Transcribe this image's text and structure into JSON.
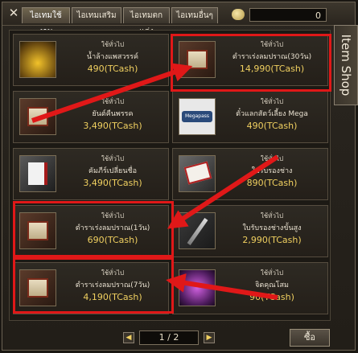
{
  "tabs": [
    {
      "label": "ไอเทมใช้งาน",
      "active": true
    },
    {
      "label": "ไอเทมเสริม",
      "active": false
    },
    {
      "label": "ไอเทมตกแต่ง",
      "active": false
    },
    {
      "label": "ไอเทมอื่นๆ",
      "active": false
    }
  ],
  "cash_balance": "0",
  "side_label": "Item Shop",
  "items": [
    {
      "category": "ใช้ทั่วไป",
      "name": "น้ำล้างแพสวรรค์",
      "price": "490(TCash)",
      "icon": "potion-icon"
    },
    {
      "category": "ใช้ทั่วไป",
      "name": "ตำราเร่งลมปราณ(30วัน)",
      "price": "14,990(TCash)",
      "icon": "scroll-icon"
    },
    {
      "category": "ใช้ทั่วไป",
      "name": "ยันต์คืนพรรค",
      "price": "3,490(TCash)",
      "icon": "scroll-icon"
    },
    {
      "category": "ใช้ทั่วไป",
      "name": "ตั๋วแลกสัตว์เลี้ยง Mega",
      "price": "490(TCash)",
      "icon": "megapass-ticket-icon"
    },
    {
      "category": "ใช้ทั่วไป",
      "name": "คัมภีร์เปลี่ยนชื่อ",
      "price": "3,490(TCash)",
      "icon": "book-icon"
    },
    {
      "category": "ใช้ทั่วไป",
      "name": "ใบรับรองช่าง",
      "price": "890(TCash)",
      "icon": "card-icon"
    },
    {
      "category": "ใช้ทั่วไป",
      "name": "ตำราเร่งลมปราณ(1วัน)",
      "price": "690(TCash)",
      "icon": "scroll-icon"
    },
    {
      "category": "ใช้ทั่วไป",
      "name": "ใบรับรองช่างขั้นสูง",
      "price": "2,990(TCash)",
      "icon": "sword-icon"
    },
    {
      "category": "ใช้ทั่วไป",
      "name": "ตำราเร่งลมปราณ(7วัน)",
      "price": "4,190(TCash)",
      "icon": "scroll-icon"
    },
    {
      "category": "ใช้ทั่วไป",
      "name": "จิตคุณโสม",
      "price": "90(TCash)",
      "icon": "purple-orb-icon"
    }
  ],
  "pager": {
    "text": "1 / 2",
    "prev": "◀",
    "next": "▶"
  },
  "buy_label": "ซื้อ",
  "annotation_color": "#e01818"
}
